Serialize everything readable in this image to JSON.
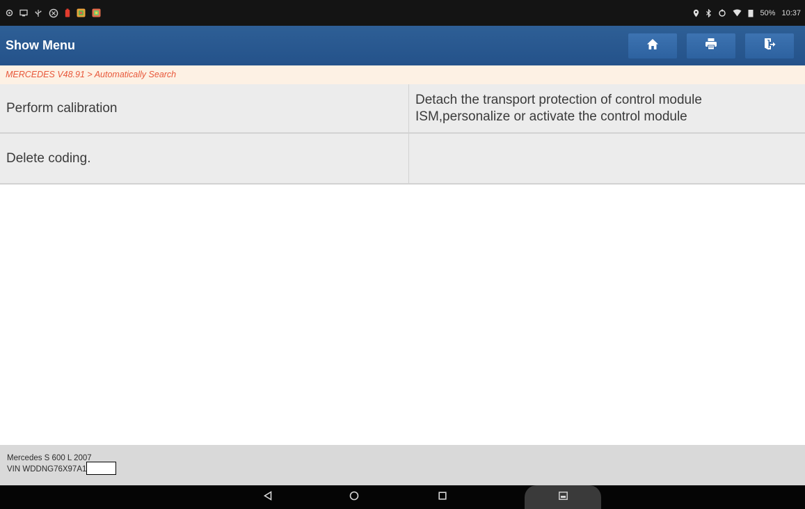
{
  "status_bar": {
    "left_icons": [
      "circle-icon",
      "screen-icon",
      "usb-icon",
      "settings-icon",
      "battery-alert-icon",
      "app-icon",
      "app-icon"
    ],
    "right_icons": [
      "location-icon",
      "bluetooth-icon",
      "sync-icon",
      "wifi-icon",
      "signal-icon"
    ],
    "battery": "50%",
    "time": "10:37"
  },
  "header": {
    "title": "Show Menu",
    "buttons": [
      {
        "name": "home-button",
        "icon": "home-icon"
      },
      {
        "name": "print-button",
        "icon": "printer-icon"
      },
      {
        "name": "exit-button",
        "icon": "exit-icon"
      }
    ],
    "accent": "#24528a"
  },
  "breadcrumb": "MERCEDES V48.91 > Automatically Search",
  "menu": {
    "rows": [
      {
        "label": "Perform calibration",
        "description": "Detach the transport protection of control module ISM,personalize or activate the control module"
      },
      {
        "label": "Delete coding.",
        "description": ""
      }
    ]
  },
  "footer": {
    "vehicle": "Mercedes S 600 L 2007",
    "vin": "VIN WDDNG76X97A1"
  },
  "nav_bar": {
    "buttons": [
      "back-icon",
      "home-circle-icon",
      "recents-icon",
      "screenshot-icon"
    ]
  }
}
